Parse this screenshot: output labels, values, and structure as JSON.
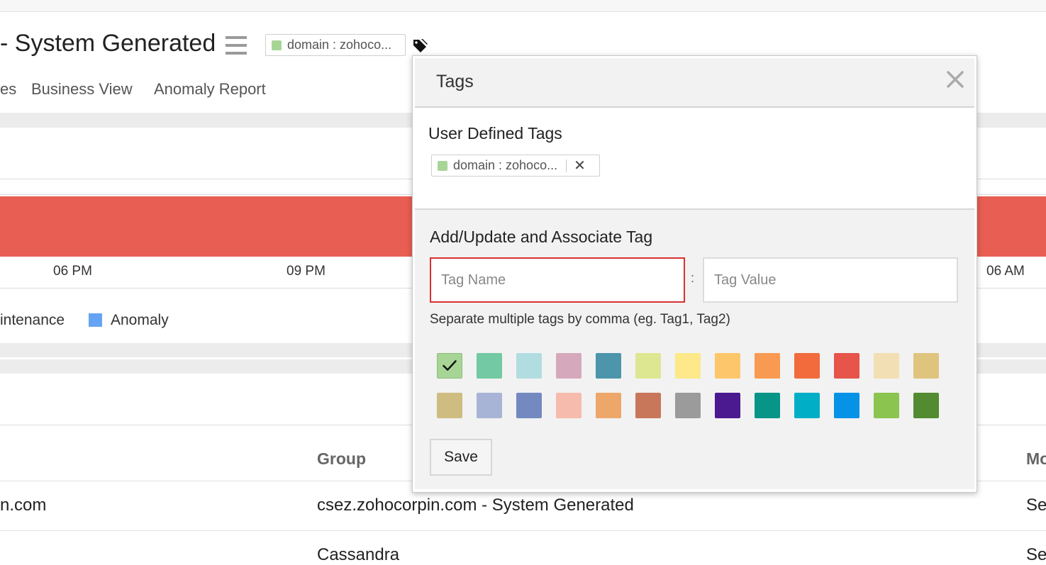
{
  "header": {
    "title": "- System Generated",
    "tag_chip": "domain : zohoco..."
  },
  "subnav": {
    "items": [
      "es",
      "Business View",
      "Anomaly Report"
    ]
  },
  "timeline": {
    "labels": [
      "06 PM",
      "09 PM",
      "06 AM"
    ],
    "bar_color": "#e85e52"
  },
  "legend": {
    "maintenance": "intenance",
    "anomaly": "Anomaly",
    "anomaly_color": "#64a4f3"
  },
  "table": {
    "columns": [
      "Group",
      "Mo"
    ],
    "rows": [
      {
        "name": "n.com",
        "group": "csez.zohocorpin.com - System Generated",
        "mo": "Se"
      },
      {
        "name": "",
        "group": "Cassandra",
        "mo": "Se"
      }
    ]
  },
  "modal": {
    "title": "Tags",
    "user_defined_title": "User Defined Tags",
    "user_tag": "domain : zohoco...",
    "add_title": "Add/Update and Associate Tag",
    "tag_name_placeholder": "Tag Name",
    "tag_value_placeholder": "Tag Value",
    "colon": ":",
    "hint": "Separate multiple tags by comma (eg. Tag1, Tag2)",
    "selected_color": "#a7d596",
    "colors": [
      "#a7d596",
      "#72c9a3",
      "#b2dde0",
      "#d5a9bb",
      "#4c95aa",
      "#dde791",
      "#fde88a",
      "#fec66a",
      "#f89a52",
      "#f16b3d",
      "#e6544a",
      "#f2e0b4",
      "#dfc47e",
      "#cfbc80",
      "#a8b4d6",
      "#7389bf",
      "#f6bbad",
      "#eda76a",
      "#c8775b",
      "#9b9b9b",
      "#4b1990",
      "#069587",
      "#00aec6",
      "#0592e7",
      "#8bc44f",
      "#528b30"
    ],
    "save_label": "Save"
  }
}
